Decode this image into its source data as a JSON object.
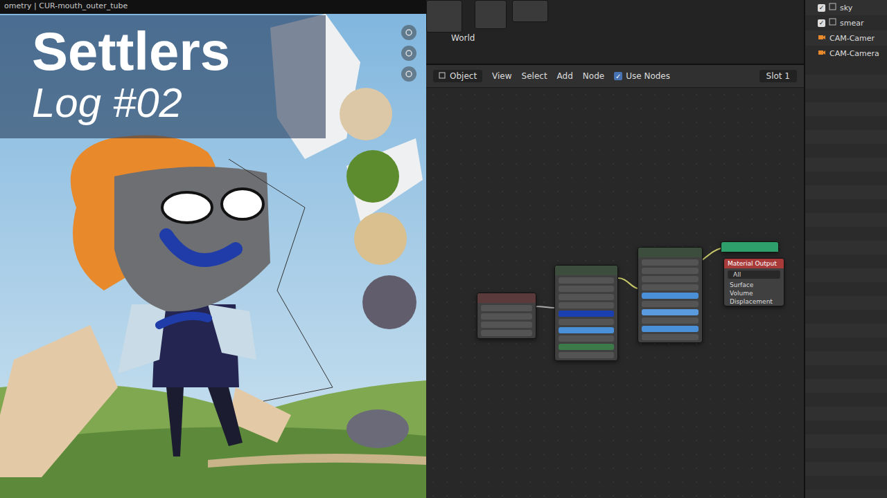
{
  "viewport": {
    "header_text": "ometry | CUR-mouth_outer_tube"
  },
  "overlay": {
    "title": "Settlers",
    "subtitle": "Log #02"
  },
  "world_editor": {
    "label": "World"
  },
  "node_header": {
    "mode": "Object",
    "menus": [
      "View",
      "Select",
      "Add",
      "Node"
    ],
    "use_nodes": {
      "label": "Use Nodes",
      "checked": true
    },
    "slot": "Slot 1"
  },
  "nodes": [
    {
      "title": "Material Output",
      "dropdown": "All",
      "sockets": [
        "Surface",
        "Volume",
        "Displacement"
      ]
    }
  ],
  "outliner": {
    "items": [
      {
        "label": "sky",
        "checked": true,
        "kind": "object"
      },
      {
        "label": "smear",
        "checked": true,
        "kind": "object"
      },
      {
        "label": "CAM-Camer",
        "checked": false,
        "kind": "camera"
      },
      {
        "label": "CAM-Camera",
        "checked": false,
        "kind": "camera"
      }
    ]
  }
}
